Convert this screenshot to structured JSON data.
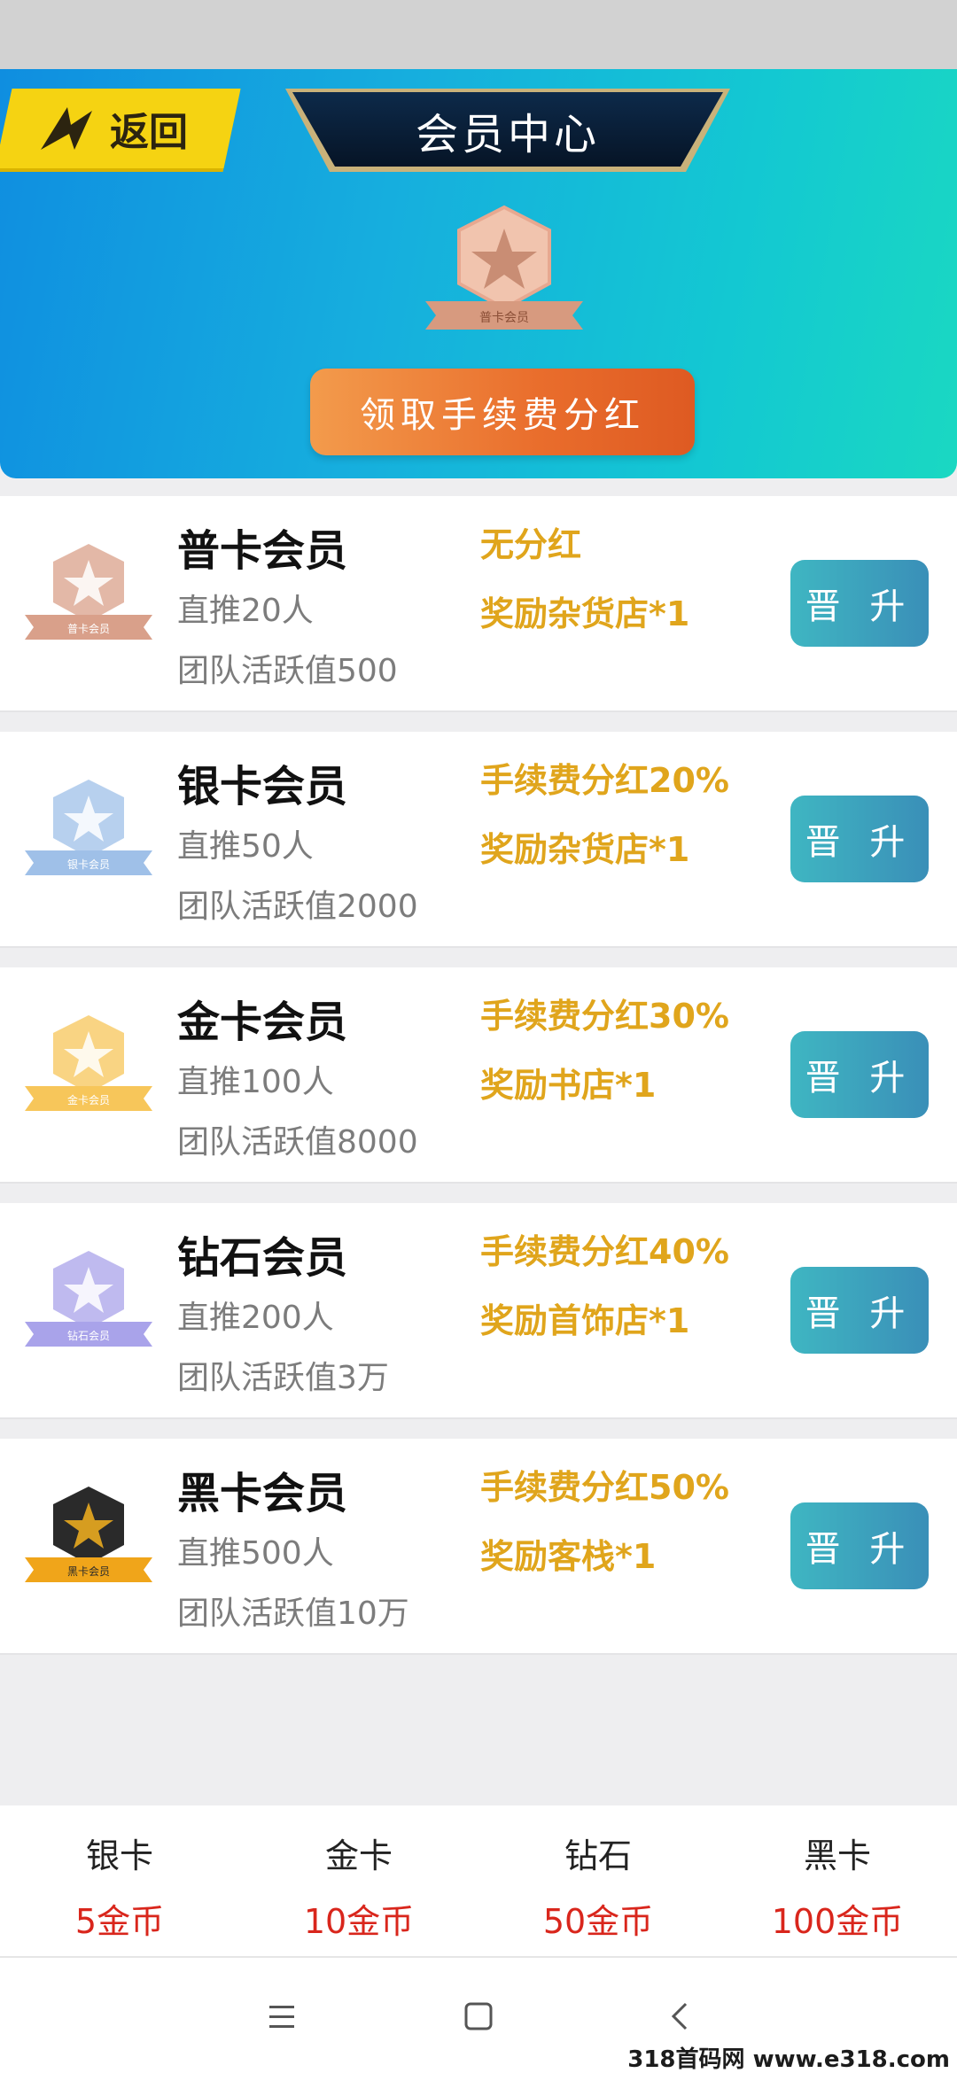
{
  "header": {
    "back_label": "返回",
    "title": "会员中心",
    "current_badge_label": "普卡会员",
    "claim_button_label": "领取手续费分红"
  },
  "tiers": [
    {
      "name": "普卡会员",
      "direct": "直推20人",
      "team": "团队活跃值500",
      "benefit1": "无分红",
      "benefit2": "奖励杂货店*1",
      "badge_label": "普卡会员",
      "upgrade_label": "晋 升",
      "color": "#d9a08a"
    },
    {
      "name": "银卡会员",
      "direct": "直推50人",
      "team": "团队活跃值2000",
      "benefit1": "手续费分红20%",
      "benefit2": "奖励杂货店*1",
      "badge_label": "银卡会员",
      "upgrade_label": "晋 升",
      "color": "#9fc0e8"
    },
    {
      "name": "金卡会员",
      "direct": "直推100人",
      "team": "团队活跃值8000",
      "benefit1": "手续费分红30%",
      "benefit2": "奖励书店*1",
      "badge_label": "金卡会员",
      "upgrade_label": "晋 升",
      "color": "#f7c65a"
    },
    {
      "name": "钻石会员",
      "direct": "直推200人",
      "team": "团队活跃值3万",
      "benefit1": "手续费分红40%",
      "benefit2": "奖励首饰店*1",
      "badge_label": "钻石会员",
      "upgrade_label": "晋 升",
      "color": "#a9a3ea"
    },
    {
      "name": "黑卡会员",
      "direct": "直推500人",
      "team": "团队活跃值10万",
      "benefit1": "手续费分红50%",
      "benefit2": "奖励客栈*1",
      "badge_label": "黑卡会员",
      "upgrade_label": "晋 升",
      "color": "#2a2a2a"
    }
  ],
  "prices": [
    {
      "name": "银卡",
      "amount": "5金币"
    },
    {
      "name": "金卡",
      "amount": "10金币"
    },
    {
      "name": "钻石",
      "amount": "50金币"
    },
    {
      "name": "黑卡",
      "amount": "100金币"
    }
  ],
  "nav": {
    "icons": [
      "menu-icon",
      "home-square-icon",
      "back-chevron-icon"
    ]
  },
  "watermark": "318首码网 www.e318.com",
  "colors": {
    "accent_gold": "#e0a51c",
    "price_red": "#d9261c",
    "upgrade_teal": "#3a9fbf"
  }
}
